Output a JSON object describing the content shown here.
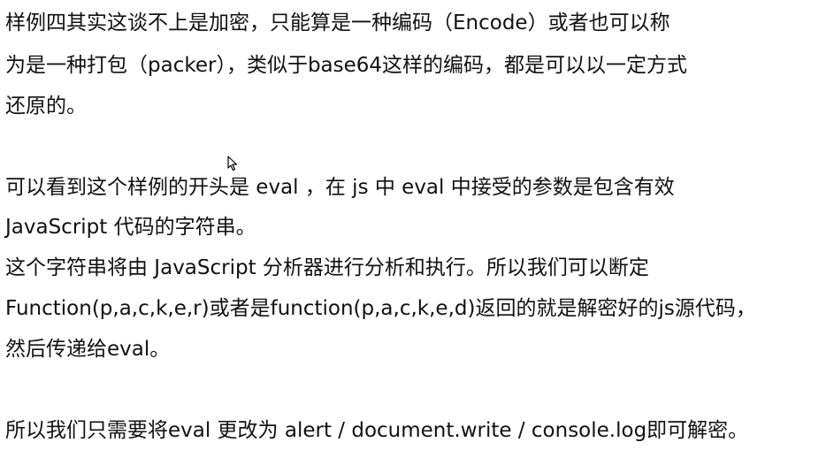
{
  "paragraphs": [
    {
      "lines": [
        "样例四其实这谈不上是加密，只能算是一种编码（Encode）或者也可以称",
        "为是一种打包（packer），类似于base64这样的编码，都是可以以一定方式",
        "还原的。"
      ]
    },
    {
      "lines": [
        "可以看到这个样例的开头是 eval ，在 js 中 eval 中接受的参数是包含有效",
        "JavaScript 代码的字符串。",
        "这个字符串将由 JavaScript 分析器进行分析和执行。所以我们可以断定",
        "Function(p,a,c,k,e,r)或者是function(p,a,c,k,e,d)返回的就是解密好的js源代码，",
        "然后传递给eval。"
      ]
    },
    {
      "lines": [
        "所以我们只需要将eval 更改为 alert / document.write / console.log即可解密。"
      ]
    }
  ],
  "cursor_icon": "mouse-pointer-icon"
}
